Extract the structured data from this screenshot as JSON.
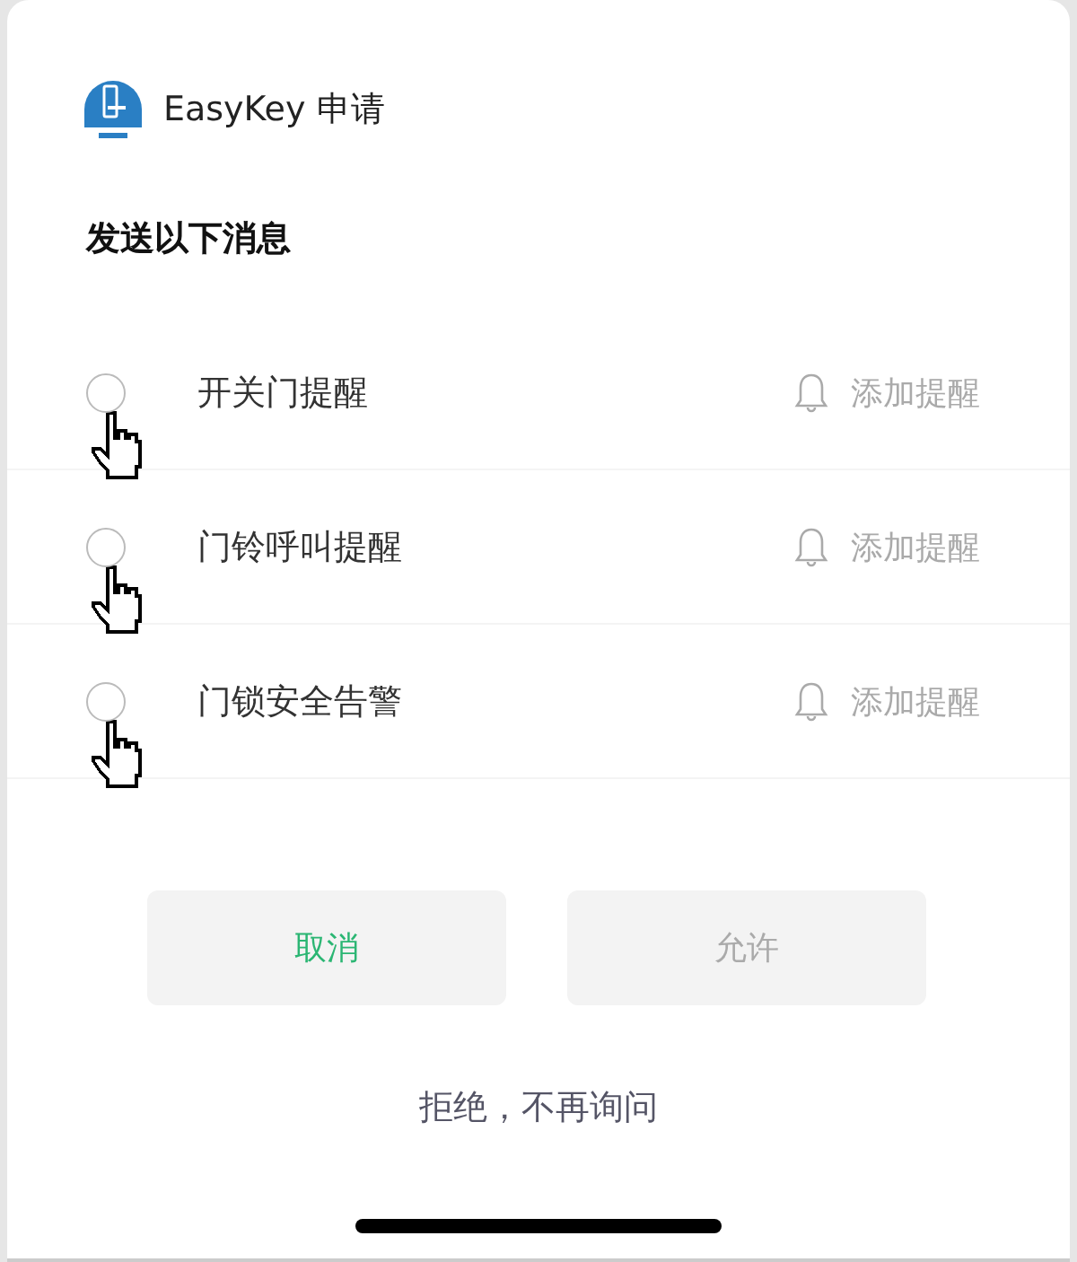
{
  "app": {
    "name": "EasyKey 申请"
  },
  "heading": "发送以下消息",
  "options": [
    {
      "label": "开关门提醒",
      "checked": false,
      "action": "添加提醒"
    },
    {
      "label": "门铃呼叫提醒",
      "checked": false,
      "action": "添加提醒"
    },
    {
      "label": "门锁安全告警",
      "checked": false,
      "action": "添加提醒"
    }
  ],
  "buttons": [
    {
      "label": "取消",
      "disabled": false
    },
    {
      "label": "允许",
      "disabled": true
    }
  ],
  "refuse_link": "拒绝，不再询问"
}
